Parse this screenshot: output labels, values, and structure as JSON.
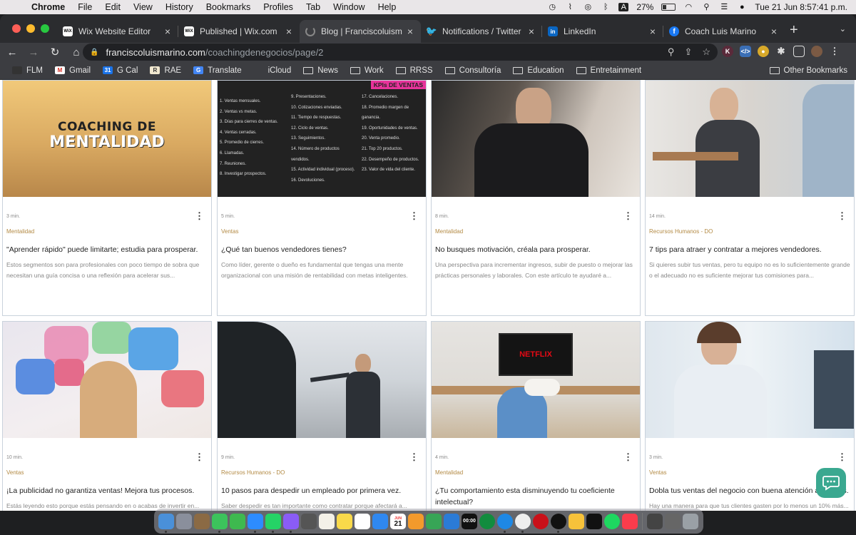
{
  "menubar": {
    "app": "Chrome",
    "items": [
      "File",
      "Edit",
      "View",
      "History",
      "Bookmarks",
      "Profiles",
      "Tab",
      "Window",
      "Help"
    ],
    "battery": "27%",
    "datetime": "Tue 21 Jun  8:57:41 p.m."
  },
  "tabs": [
    {
      "label": "Wix Website Editor",
      "icon": "wix-icon",
      "color": "#ffffff"
    },
    {
      "label": "Published | Wix.com",
      "icon": "wix-icon",
      "color": "#ffffff"
    },
    {
      "label": "Blog | Franciscoluismarino",
      "icon": "loading-icon",
      "color": "#888888"
    },
    {
      "label": "Notifications / Twitter",
      "icon": "twitter-icon",
      "color": "#1d9bf0"
    },
    {
      "label": "LinkedIn",
      "icon": "linkedin-icon",
      "color": "#0a66c2"
    },
    {
      "label": "Coach Luis Marino",
      "icon": "facebook-icon",
      "color": "#1877f2"
    }
  ],
  "address": {
    "host": "franciscoluismarino.com",
    "path": "/coachingdenegocios/page/2"
  },
  "bookmarks": [
    {
      "label": "FLM",
      "kind": "site"
    },
    {
      "label": "Gmail",
      "kind": "gmail"
    },
    {
      "label": "G Cal",
      "kind": "calendar"
    },
    {
      "label": "RAE",
      "kind": "rae"
    },
    {
      "label": "Translate",
      "kind": "translate"
    },
    {
      "label": "iCloud",
      "kind": "apple"
    },
    {
      "label": "News",
      "kind": "folder"
    },
    {
      "label": "Work",
      "kind": "folder"
    },
    {
      "label": "RRSS",
      "kind": "folder"
    },
    {
      "label": "Consultoría",
      "kind": "folder"
    },
    {
      "label": "Education",
      "kind": "folder"
    },
    {
      "label": "Entretainment",
      "kind": "folder"
    }
  ],
  "other_bookmarks": "Other Bookmarks",
  "posts": [
    {
      "read": "3 min.",
      "category": "Mentalidad",
      "title": "\"Aprender rápido\" puede limitarte; estudia para prosperar.",
      "excerpt": "Estos segmentos son para profesionales con poco tiempo de sobra que necesitan una guía concisa o una reflexión para acelerar sus...",
      "image": "coaching-mentalidad"
    },
    {
      "read": "5 min.",
      "category": "Ventas",
      "title": "¿Qué tan buenos vendedores tienes?",
      "excerpt": "Como líder, gerente o dueño es fundamental que tengas una mente organizacional con una misión de rentabilidad con metas inteligentes.",
      "image": "kpis-ventas"
    },
    {
      "read": "8 min.",
      "category": "Mentalidad",
      "title": "No busques motivación, créala para prosperar.",
      "excerpt": "Una perspectiva para incrementar ingresos, subir de puesto o mejorar las prácticas personales y laborales. Con este artículo te ayudaré a...",
      "image": "businessman"
    },
    {
      "read": "14 min.",
      "category": "Recursos Humanos - DO",
      "title": "7 tips para atraer y contratar a mejores vendedores.",
      "excerpt": "Si quieres subir tus ventas, pero tu equipo no es lo suficientemente grande o el adecuado no es suficiente mejorar tus comisiones para...",
      "image": "handshake"
    },
    {
      "read": "10 min.",
      "category": "Ventas",
      "title": "¡La publicidad no garantiza ventas! Mejora tus procesos.",
      "excerpt": "Estás leyendo esto porque estás pensando en o acabas de invertir en...",
      "image": "social-media"
    },
    {
      "read": "9 min.",
      "category": "Recursos Humanos - DO",
      "title": "10 pasos para despedir un empleado por primera vez.",
      "excerpt": "Saber despedir es tan importante como contratar porque afectará a...",
      "image": "boss-pointing"
    },
    {
      "read": "4 min.",
      "category": "Mentalidad",
      "title": "¿Tu comportamiento esta disminuyendo tu coeficiente intelectual?",
      "excerpt": "",
      "image": "netflix-couch"
    },
    {
      "read": "3 min.",
      "category": "Ventas",
      "title": "Dobla tus ventas del negocio con buena atención a clientes.",
      "excerpt": "Hay una manera para que tus clientes gasten por lo menos un 10% más...",
      "image": "call-center"
    }
  ],
  "coaching_image": {
    "line1": "COACHING DE",
    "line2": "MENTALIDAD"
  },
  "kpi_image": {
    "badge": "KPIs DE VENTAS",
    "col1": [
      "1.  Ventas mensuales.",
      "2.  Ventas vs metas.",
      "3.  Días para cierres de ventas.",
      "4.  Ventas cerradas.",
      "5.  Promedio de cierres.",
      "6.  Llamadas.",
      "7.  Reuniones.",
      "8.  Investigar prospectos."
    ],
    "col2": [
      "9.  Presentaciones.",
      "10. Cotizaciones enviadas.",
      "11. Tiempo de respuestas.",
      "12. Ciclo de ventas.",
      "13. Seguimientos.",
      "14. Número de productos vendidos.",
      "15. Actividad individual (proceso).",
      "16. Devoluciones."
    ],
    "col3": [
      "17. Cancelaciones.",
      "18. Promedio margen de ganancia.",
      "19. Oportunidades de ventas.",
      "20. Venta promedio.",
      "21. Top 20 productos.",
      "22. Desempeño de productos.",
      "23. Valor de vida del cliente."
    ]
  },
  "netflix_label": "NETFLIX",
  "dock_clock": "00:00",
  "dock_calendar": {
    "month": "JUN",
    "day": "21"
  }
}
